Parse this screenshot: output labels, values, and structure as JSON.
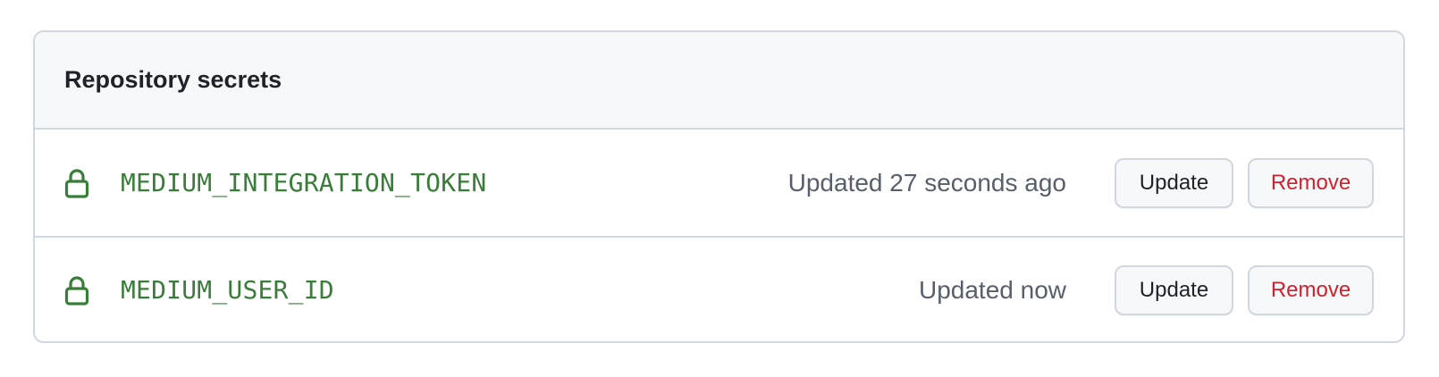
{
  "panel": {
    "title": "Repository secrets"
  },
  "secrets": [
    {
      "name": "MEDIUM_INTEGRATION_TOKEN",
      "updated": "Updated 27 seconds ago",
      "update_label": "Update",
      "remove_label": "Remove",
      "icon": "lock-icon"
    },
    {
      "name": "MEDIUM_USER_ID",
      "updated": "Updated now",
      "update_label": "Update",
      "remove_label": "Remove",
      "icon": "lock-icon"
    }
  ],
  "colors": {
    "secret_name": "#3a7d3a",
    "remove_text": "#cf222e",
    "border": "#d0d7de",
    "header_bg": "#f6f8fa"
  }
}
